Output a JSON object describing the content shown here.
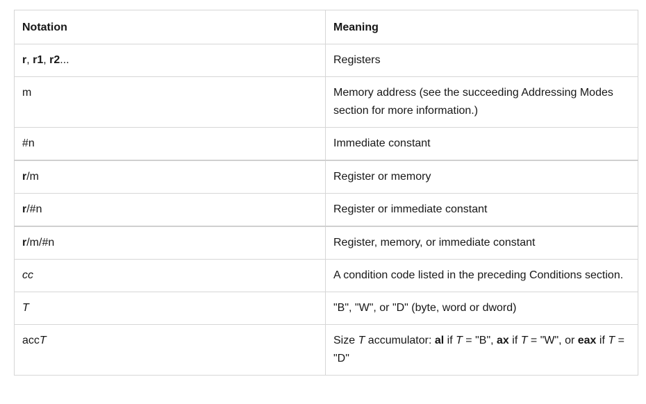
{
  "table": {
    "headers": {
      "notation": "Notation",
      "meaning": "Meaning"
    },
    "rows": [
      {
        "notation": {
          "parts": [
            {
              "text": "r",
              "bold": true
            },
            {
              "text": ", "
            },
            {
              "text": "r1",
              "bold": true
            },
            {
              "text": ", "
            },
            {
              "text": "r2",
              "bold": true
            },
            {
              "text": "..."
            }
          ]
        },
        "meaning": {
          "parts": [
            {
              "text": "Registers"
            }
          ]
        }
      },
      {
        "notation": {
          "parts": [
            {
              "text": "m"
            }
          ]
        },
        "meaning": {
          "parts": [
            {
              "text": "Memory address (see the succeeding Addressing Modes section for more information.)"
            }
          ]
        }
      },
      {
        "notation": {
          "parts": [
            {
              "text": "#n"
            }
          ]
        },
        "meaning": {
          "parts": [
            {
              "text": "Immediate constant"
            }
          ]
        }
      },
      {
        "notation": {
          "parts": [
            {
              "text": "r",
              "bold": true
            },
            {
              "text": "/m"
            }
          ]
        },
        "meaning": {
          "parts": [
            {
              "text": "Register or memory"
            }
          ]
        }
      },
      {
        "notation": {
          "parts": [
            {
              "text": "r",
              "bold": true
            },
            {
              "text": "/#n"
            }
          ]
        },
        "meaning": {
          "parts": [
            {
              "text": "Register or immediate constant"
            }
          ]
        }
      },
      {
        "notation": {
          "parts": [
            {
              "text": "r",
              "bold": true
            },
            {
              "text": "/m/#n"
            }
          ]
        },
        "meaning": {
          "parts": [
            {
              "text": "Register, memory, or immediate constant"
            }
          ]
        }
      },
      {
        "notation": {
          "parts": [
            {
              "text": "cc",
              "italic": true
            }
          ]
        },
        "meaning": {
          "parts": [
            {
              "text": "A condition code listed in the preceding Conditions section."
            }
          ]
        }
      },
      {
        "notation": {
          "parts": [
            {
              "text": "T",
              "italic": true
            }
          ]
        },
        "meaning": {
          "parts": [
            {
              "text": "\"B\", \"W\", or \"D\" (byte, word or dword)"
            }
          ]
        }
      },
      {
        "notation": {
          "parts": [
            {
              "text": "acc"
            },
            {
              "text": "T",
              "italic": true
            }
          ]
        },
        "meaning": {
          "parts": [
            {
              "text": "Size "
            },
            {
              "text": "T",
              "italic": true
            },
            {
              "text": " accumulator: "
            },
            {
              "text": "al",
              "bold": true
            },
            {
              "text": " if "
            },
            {
              "text": "T",
              "italic": true
            },
            {
              "text": " = \"B\", "
            },
            {
              "text": "ax",
              "bold": true
            },
            {
              "text": " if "
            },
            {
              "text": "T",
              "italic": true
            },
            {
              "text": " = \"W\", or "
            },
            {
              "text": "eax",
              "bold": true
            },
            {
              "text": " if "
            },
            {
              "text": "T",
              "italic": true
            },
            {
              "text": " = \"D\""
            }
          ]
        }
      }
    ]
  }
}
